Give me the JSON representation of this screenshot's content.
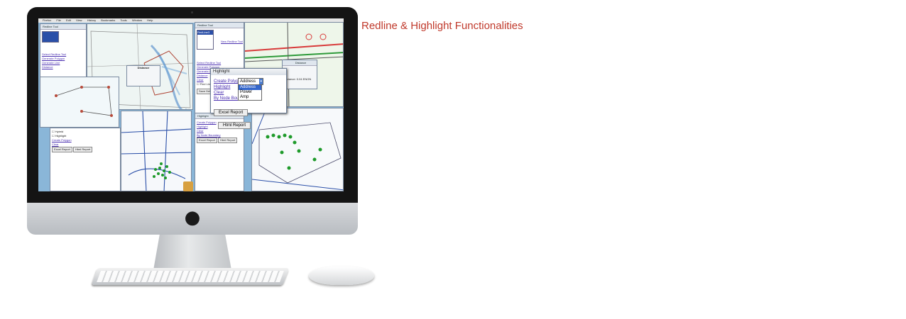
{
  "headline": "Redline & Highlight Functionalities",
  "accent_color": "#c0392b",
  "screen": {
    "menu_items": [
      "Firefox",
      "File",
      "Edit",
      "View",
      "History",
      "Bookmarks",
      "Tools",
      "Window",
      "Help"
    ],
    "redline_tool": {
      "title": "Redline Tool",
      "list_item": "RedLine3",
      "new_link": "New Redline Tool",
      "links": [
        "Select Redline Tool",
        "Generate Polygon",
        "Generate Line",
        "Distance",
        "Clear"
      ],
      "checkbox_label": "Find Line Coordinates",
      "save_button": "Save Details",
      "redline_button": "RedLine"
    },
    "distance_box": {
      "title": "Distance",
      "value": "Distance: 0.04 ENON"
    },
    "highlight": {
      "title": "Highlight",
      "links": [
        "Create Polygon",
        "Highlight",
        "Clear",
        "By Node Boundary"
      ],
      "select_value": "Address",
      "options": [
        "Address",
        "Power",
        "Amp"
      ],
      "excel_button": "Excel Report",
      "html_button": "Html Report"
    }
  }
}
